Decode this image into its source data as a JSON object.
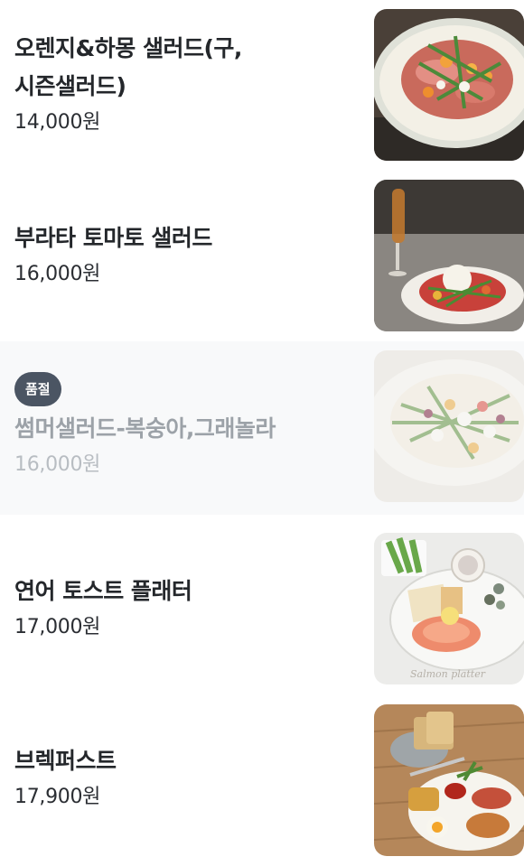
{
  "menu": {
    "items": [
      {
        "name_line1": "오렌지&하몽 샐러드(구,",
        "name_line2": "시즌샐러드)",
        "price": "14,000원",
        "image": "salad-plate-image",
        "sold_out": false
      },
      {
        "name_line1": "부라타 토마토 샐러드",
        "price": "16,000원",
        "image": "burrata-salad-image",
        "sold_out": false
      },
      {
        "badge": "품절",
        "name_line1": "썸머샐러드-복숭아,그래놀라",
        "price": "16,000원",
        "image": "summer-salad-image",
        "sold_out": true
      },
      {
        "name_line1": "연어 토스트 플래터",
        "price": "17,000원",
        "image": "salmon-platter-image",
        "image_caption": "Salmon platter",
        "sold_out": false
      },
      {
        "name_line1": "브렉퍼스트",
        "price": "17,900원",
        "image": "breakfast-plate-image",
        "sold_out": false
      }
    ]
  }
}
